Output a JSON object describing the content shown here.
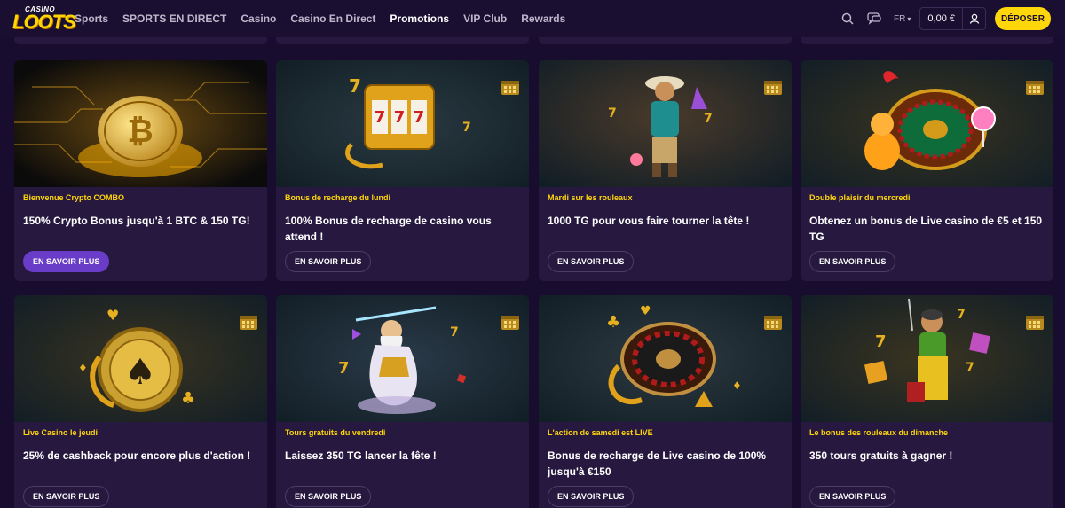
{
  "brand": {
    "logo_small": "CASINO",
    "logo_big": "LOOTS"
  },
  "nav": {
    "items": [
      {
        "label": "Sports"
      },
      {
        "label": "SPORTS EN DIRECT"
      },
      {
        "label": "Casino"
      },
      {
        "label": "Casino En Direct"
      },
      {
        "label": "Promotions"
      },
      {
        "label": "VIP Club"
      },
      {
        "label": "Rewards"
      }
    ],
    "active": "Promotions"
  },
  "header": {
    "language": "FR",
    "balance": "0,00 €",
    "deposit_label": "DÉPOSER",
    "icons": [
      "search-icon",
      "chat-icon",
      "user-icon"
    ]
  },
  "colors": {
    "background": "#180d2e",
    "card": "#26183f",
    "accent_yellow": "#ffd60a",
    "primary_button": "#6a3dc8"
  },
  "promotions": [
    {
      "subtitle": "Bienvenue Crypto COMBO",
      "title": "150% Crypto Bonus jusqu'à 1 BTC & 150 TG!",
      "button": "EN SAVOIR PLUS",
      "image": "bitcoin-coin"
    },
    {
      "subtitle": "Bonus de recharge du lundi",
      "title": "100% Bonus de recharge de casino vous attend !",
      "button": "EN SAVOIR PLUS",
      "image": "slot-machine"
    },
    {
      "subtitle": "Mardi sur les rouleaux",
      "title": "1000 TG pour vous faire tourner la tête !",
      "button": "EN SAVOIR PLUS",
      "image": "cowboy-character"
    },
    {
      "subtitle": "Double plaisir du mercredi",
      "title": "Obtenez un bonus de Live casino de €5 et 150 TG",
      "button": "EN SAVOIR PLUS",
      "image": "roulette-gummy-bear"
    },
    {
      "subtitle": "Live Casino le jeudi",
      "title": "25% de cashback pour encore plus d'action !",
      "button": "EN SAVOIR PLUS",
      "image": "poker-chip-spade"
    },
    {
      "subtitle": "Tours gratuits du vendredi",
      "title": "Laissez 350 TG lancer la fête !",
      "button": "EN SAVOIR PLUS",
      "image": "zeus-character"
    },
    {
      "subtitle": "L'action de samedi est LIVE",
      "title": "Bonus de recharge de Live casino de 100% jusqu'à €150",
      "button": "EN SAVOIR PLUS",
      "image": "roulette-wheel"
    },
    {
      "subtitle": "Le bonus des rouleaux du dimanche",
      "title": "350 tours gratuits à gagner !",
      "button": "EN SAVOIR PLUS",
      "image": "miner-character"
    }
  ]
}
